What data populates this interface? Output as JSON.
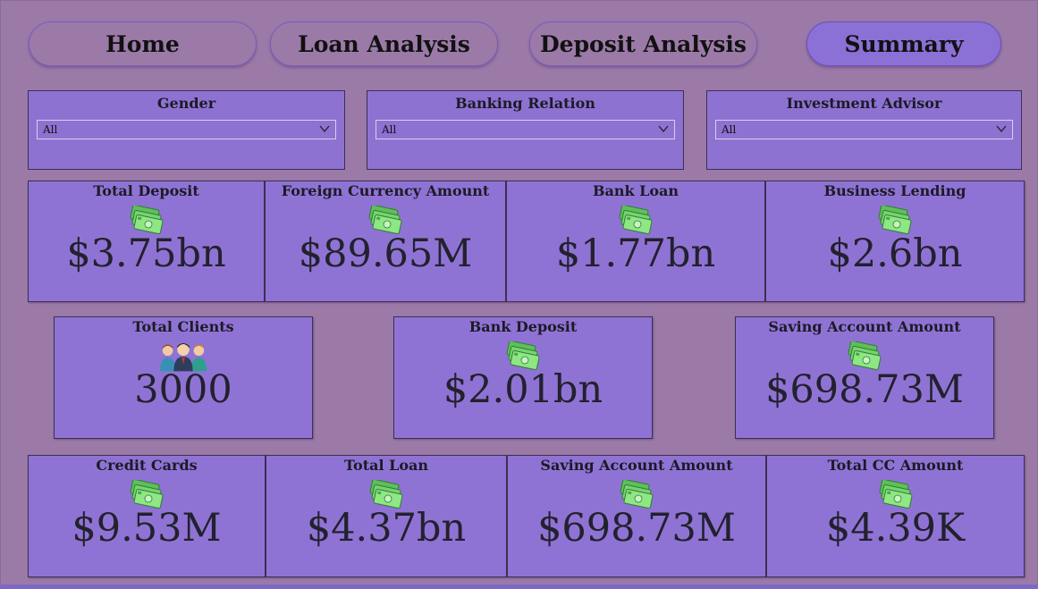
{
  "nav": {
    "home": "Home",
    "loan_analysis": "Loan Analysis",
    "deposit_analysis": "Deposit Analysis",
    "summary": "Summary"
  },
  "filters": {
    "gender": {
      "label": "Gender",
      "value": "All"
    },
    "banking_relation": {
      "label": "Banking Relation",
      "value": "All"
    },
    "investment_advisor": {
      "label": "Investment Advisor",
      "value": "All"
    }
  },
  "cards": {
    "total_deposit": {
      "title": "Total Deposit",
      "value": "$3.75bn",
      "icon": "money-icon"
    },
    "foreign_currency_amount": {
      "title": "Foreign Currency Amount",
      "value": "$89.65M",
      "icon": "money-icon"
    },
    "bank_loan": {
      "title": "Bank Loan",
      "value": "$1.77bn",
      "icon": "money-icon"
    },
    "business_lending": {
      "title": "Business Lending",
      "value": "$2.6bn",
      "icon": "money-icon"
    },
    "total_clients": {
      "title": "Total Clients",
      "value": "3000",
      "icon": "people-icon"
    },
    "bank_deposit": {
      "title": "Bank Deposit",
      "value": "$2.01bn",
      "icon": "money-icon"
    },
    "saving_account_amount_1": {
      "title": "Saving Account Amount",
      "value": "$698.73M",
      "icon": "money-icon"
    },
    "credit_cards": {
      "title": "Credit Cards",
      "value": "$9.53M",
      "icon": "money-icon"
    },
    "total_loan": {
      "title": "Total Loan",
      "value": "$4.37bn",
      "icon": "money-icon"
    },
    "saving_account_amount_2": {
      "title": "Saving Account Amount",
      "value": "$698.73M",
      "icon": "money-icon"
    },
    "total_cc_amount": {
      "title": "Total CC Amount",
      "value": "$4.39K",
      "icon": "money-icon"
    }
  },
  "colors": {
    "background": "#9b7aa8",
    "card": "#8f73d4",
    "active_nav": "#8b70d6",
    "money_green": "#6fd16a"
  }
}
